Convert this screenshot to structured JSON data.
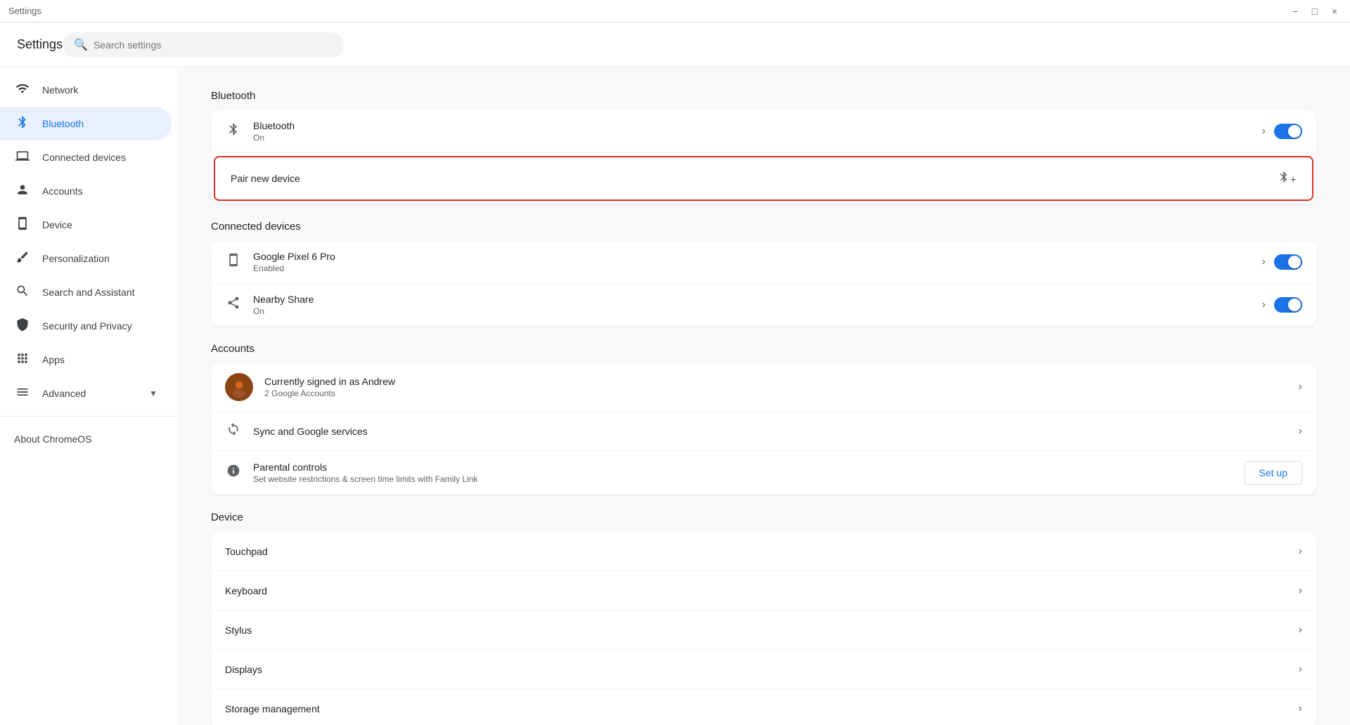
{
  "titlebar": {
    "title": "Settings",
    "minimize": "−",
    "maximize": "□",
    "close": "×"
  },
  "header": {
    "app_title": "Settings",
    "search_placeholder": "Search settings"
  },
  "sidebar": {
    "items": [
      {
        "id": "network",
        "label": "Network",
        "icon": "wifi",
        "active": false
      },
      {
        "id": "bluetooth",
        "label": "Bluetooth",
        "icon": "bt",
        "active": true
      },
      {
        "id": "connected-devices",
        "label": "Connected devices",
        "icon": "laptop",
        "active": false
      },
      {
        "id": "accounts",
        "label": "Accounts",
        "icon": "person",
        "active": false
      },
      {
        "id": "device",
        "label": "Device",
        "icon": "device",
        "active": false
      },
      {
        "id": "personalization",
        "label": "Personalization",
        "icon": "brush",
        "active": false
      },
      {
        "id": "search",
        "label": "Search and Assistant",
        "icon": "search",
        "active": false
      },
      {
        "id": "security",
        "label": "Security and Privacy",
        "icon": "shield",
        "active": false
      },
      {
        "id": "apps",
        "label": "Apps",
        "icon": "grid",
        "active": false
      },
      {
        "id": "advanced",
        "label": "Advanced",
        "icon": "advanced",
        "active": false,
        "has_arrow": true
      }
    ],
    "about": "About ChromeOS"
  },
  "main": {
    "sections": {
      "bluetooth": {
        "title": "Bluetooth",
        "bluetooth_row": {
          "label": "Bluetooth",
          "sublabel": "On",
          "toggled": true
        },
        "pair_row": {
          "label": "Pair new device"
        }
      },
      "connected_devices": {
        "title": "Connected devices",
        "items": [
          {
            "label": "Google Pixel 6 Pro",
            "sublabel": "Enabled",
            "toggled": true
          },
          {
            "label": "Nearby Share",
            "sublabel": "On",
            "toggled": true
          }
        ]
      },
      "accounts": {
        "title": "Accounts",
        "items": [
          {
            "type": "account",
            "label": "Currently signed in as Andrew",
            "sublabel": "2 Google Accounts"
          },
          {
            "type": "sync",
            "label": "Sync and Google services",
            "sublabel": ""
          },
          {
            "type": "parental",
            "label": "Parental controls",
            "sublabel": "Set website restrictions & screen time limits with Family Link",
            "has_button": true,
            "button_label": "Set up"
          }
        ]
      },
      "device": {
        "title": "Device",
        "items": [
          {
            "label": "Touchpad"
          },
          {
            "label": "Keyboard"
          },
          {
            "label": "Stylus"
          },
          {
            "label": "Displays"
          },
          {
            "label": "Storage management"
          }
        ]
      }
    }
  }
}
